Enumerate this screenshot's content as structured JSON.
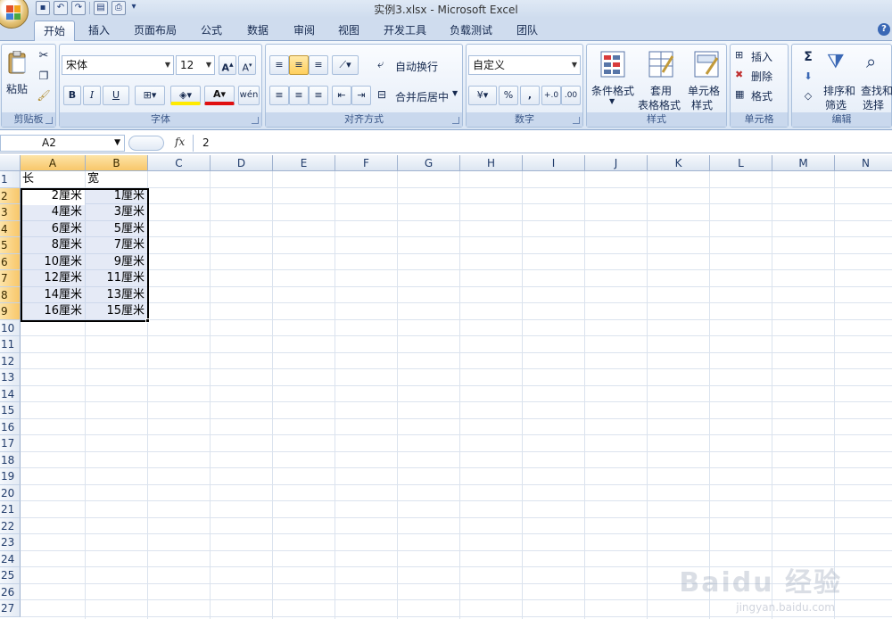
{
  "window": {
    "title": "实例3.xlsx - Microsoft Excel"
  },
  "tabs": [
    "开始",
    "插入",
    "页面布局",
    "公式",
    "数据",
    "审阅",
    "视图",
    "开发工具",
    "负载测试",
    "团队"
  ],
  "ribbon": {
    "clipboard": {
      "label": "剪贴板",
      "paste": "粘贴"
    },
    "font": {
      "label": "字体",
      "name": "宋体",
      "size": "12",
      "bold": "B",
      "italic": "I",
      "underline": "U"
    },
    "alignment": {
      "label": "对齐方式",
      "wrap": "自动换行",
      "merge": "合并后居中"
    },
    "number": {
      "label": "数字",
      "format": "自定义",
      "percent": "%",
      "comma": ","
    },
    "styles": {
      "label": "样式",
      "conditional": "条件格式",
      "table_line1": "套用",
      "table_line2": "表格格式",
      "cell_line1": "单元格",
      "cell_line2": "样式"
    },
    "cells": {
      "label": "单元格",
      "insert": "插入",
      "delete": "删除",
      "format": "格式"
    },
    "editing": {
      "label": "编辑",
      "sort_line1": "排序和",
      "sort_line2": "筛选",
      "find_line1": "查找和",
      "find_line2": "选择",
      "sum": "Σ"
    }
  },
  "formula_bar": {
    "name_box": "A2",
    "fx": "fx",
    "content": "2"
  },
  "sheet": {
    "columns": [
      "A",
      "B",
      "C",
      "D",
      "E",
      "F",
      "G",
      "H",
      "I",
      "J",
      "K",
      "L",
      "M",
      "N"
    ],
    "rows": [
      "1",
      "2",
      "3",
      "4",
      "5",
      "6",
      "7",
      "8",
      "9",
      "10",
      "11",
      "12",
      "13",
      "14",
      "15",
      "16",
      "17",
      "18",
      "19",
      "20",
      "21",
      "22",
      "23",
      "24",
      "25",
      "26",
      "27"
    ],
    "header_row": {
      "A": "长",
      "B": "宽"
    },
    "data": [
      {
        "A": "2厘米",
        "B": "1厘米"
      },
      {
        "A": "4厘米",
        "B": "3厘米"
      },
      {
        "A": "6厘米",
        "B": "5厘米"
      },
      {
        "A": "8厘米",
        "B": "7厘米"
      },
      {
        "A": "10厘米",
        "B": "9厘米"
      },
      {
        "A": "12厘米",
        "B": "11厘米"
      },
      {
        "A": "14厘米",
        "B": "13厘米"
      },
      {
        "A": "16厘米",
        "B": "15厘米"
      }
    ]
  },
  "watermark": {
    "main": "Baidu 经验",
    "sub": "jingyan.baidu.com"
  }
}
